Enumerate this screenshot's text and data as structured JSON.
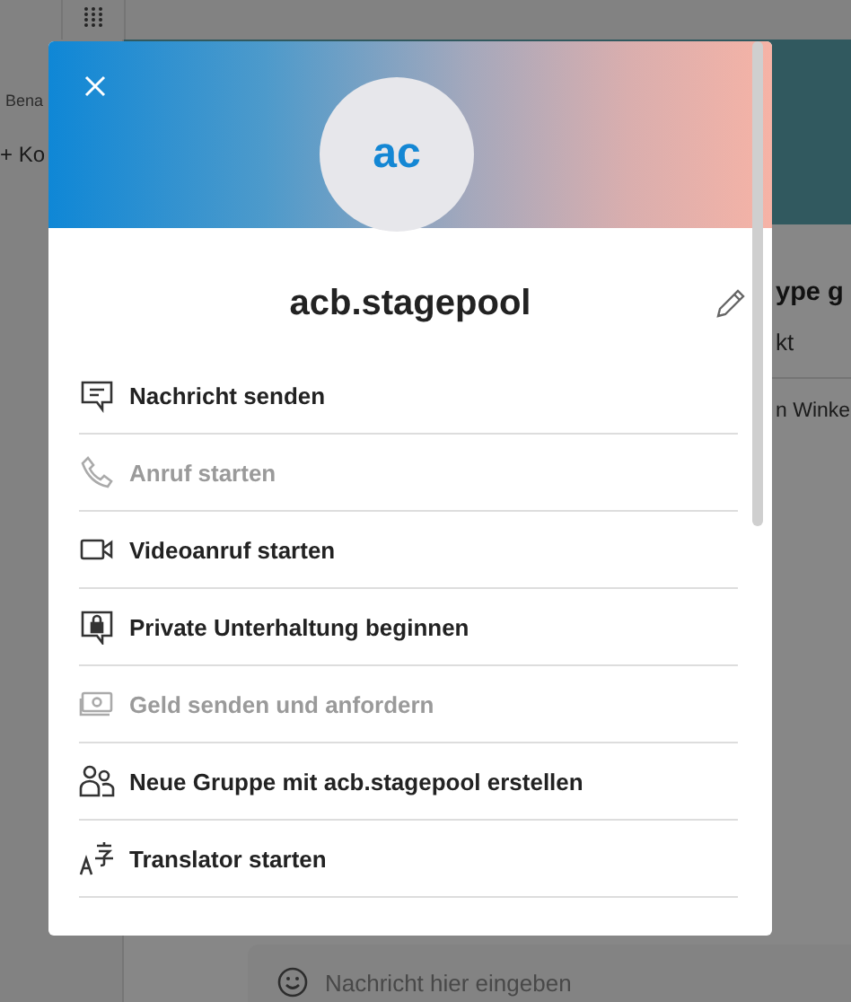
{
  "background": {
    "sidebar": {
      "tab_label": "Bena",
      "add_button": "+ Ko"
    },
    "chat": {
      "title": "ype g",
      "subtitle": "kt",
      "message": "n Winke"
    },
    "composer": {
      "placeholder": "Nachricht hier eingeben"
    }
  },
  "profile_dialog": {
    "avatar_initials": "ac",
    "name": "acb.stagepool",
    "actions": [
      {
        "kind": "message",
        "label": "Nachricht senden",
        "disabled": false
      },
      {
        "kind": "call",
        "label": "Anruf starten",
        "disabled": true
      },
      {
        "kind": "video",
        "label": "Videoanruf starten",
        "disabled": false
      },
      {
        "kind": "private",
        "label": "Private Unterhaltung beginnen",
        "disabled": false
      },
      {
        "kind": "money",
        "label": "Geld senden und anfordern",
        "disabled": true
      },
      {
        "kind": "group",
        "label": "Neue Gruppe mit acb.stagepool erstellen",
        "disabled": false
      },
      {
        "kind": "translator",
        "label": "Translator starten",
        "disabled": false
      }
    ]
  }
}
